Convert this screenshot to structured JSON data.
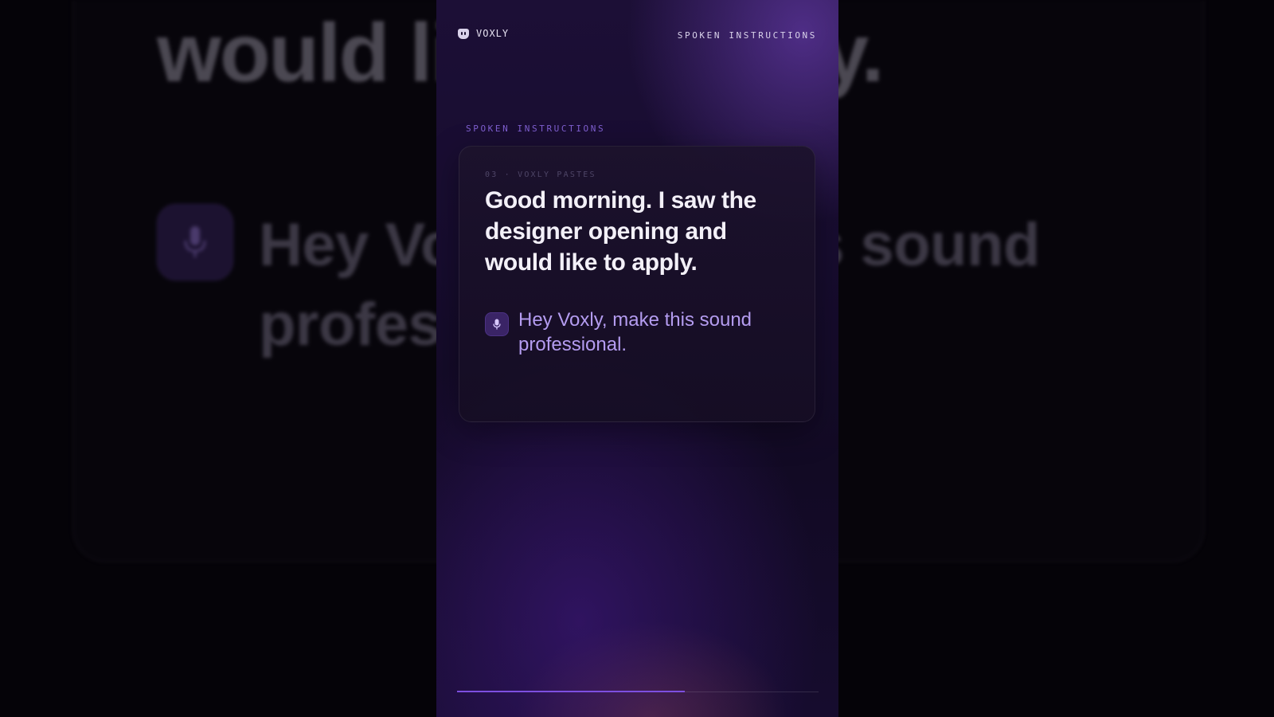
{
  "background": {
    "headline": "would like to apply.",
    "quote": "Hey Voxly, make this sound professional."
  },
  "app": {
    "brand": "VOXLY",
    "top_label": "SPOKEN INSTRUCTIONS",
    "section_label": "SPOKEN INSTRUCTIONS"
  },
  "card": {
    "kicker": "03 · VOXLY PASTES",
    "title": "Good morning. I saw the designer opening and would like to apply.",
    "instruction": "Hey Voxly, make this sound professional.",
    "mic_icon": "microphone-icon"
  },
  "progress": {
    "value": 0.63
  },
  "colors": {
    "accent": "#7d4fe0",
    "instruction_text": "#b49cf0",
    "panel": "#170c2f"
  }
}
